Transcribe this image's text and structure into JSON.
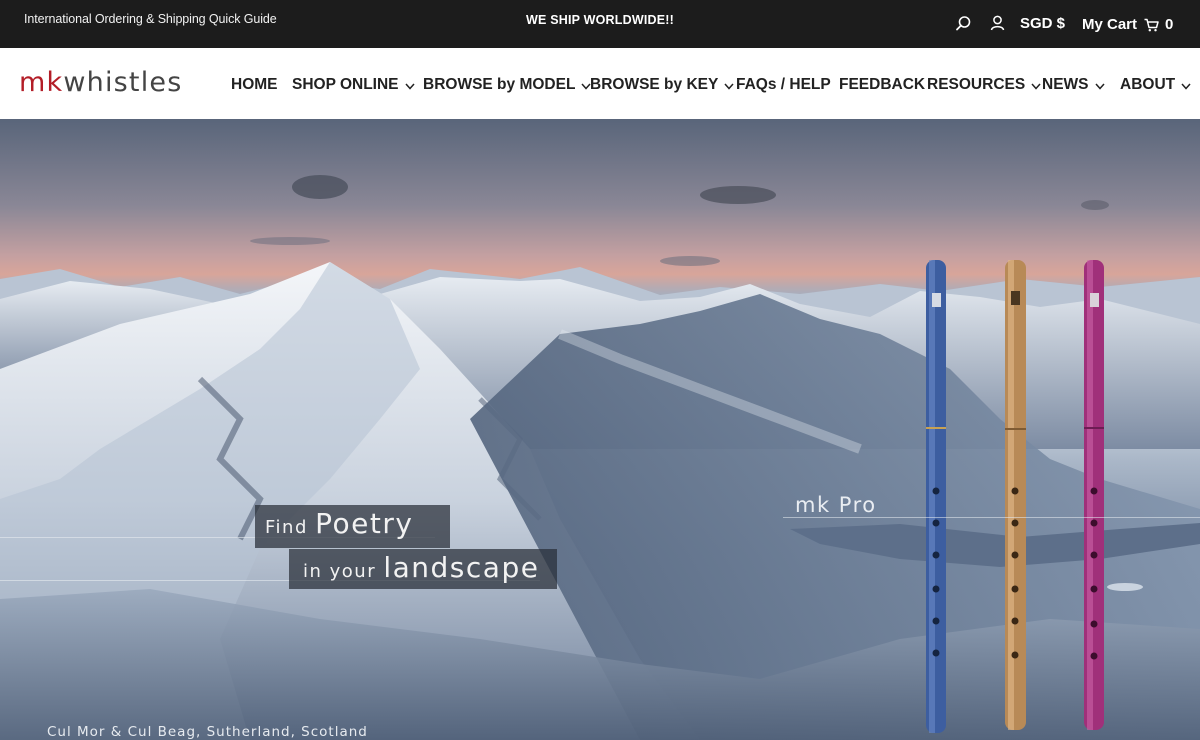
{
  "topbar": {
    "guide_link": "International Ordering & Shipping Quick Guide",
    "announcement": "WE SHIP WORLDWIDE!!",
    "currency": "SGD $",
    "cart_label": "My Cart",
    "cart_count": "0"
  },
  "logo": {
    "part1": "mk",
    "part2": "whistles"
  },
  "nav": {
    "items": [
      {
        "label": "HOME",
        "dropdown": false
      },
      {
        "label": "SHOP ONLINE",
        "dropdown": true
      },
      {
        "label": "BROWSE by MODEL",
        "dropdown": true
      },
      {
        "label": "BROWSE by KEY",
        "dropdown": true
      },
      {
        "label": "FAQs / HELP",
        "dropdown": false
      },
      {
        "label": "FEEDBACK",
        "dropdown": false
      },
      {
        "label": "RESOURCES",
        "dropdown": true
      },
      {
        "label": "NEWS",
        "dropdown": true
      },
      {
        "label": "ABOUT",
        "dropdown": true
      }
    ]
  },
  "hero": {
    "caption_line1_small": "Find",
    "caption_line1_big": "Poetry",
    "caption_line2_small": "in your",
    "caption_line2_big": "landscape",
    "model_label": "mk Pro",
    "location": "Cul Mor & Cul Beag, Sutherland, Scotland",
    "whistles": [
      {
        "color": "#3d5ea0",
        "name": "blue-whistle"
      },
      {
        "color": "#b88a57",
        "name": "gold-whistle"
      },
      {
        "color": "#a0307a",
        "name": "magenta-whistle"
      }
    ]
  },
  "colors": {
    "topbar_bg": "#1c1c1c",
    "brand_red": "#b31d27"
  }
}
